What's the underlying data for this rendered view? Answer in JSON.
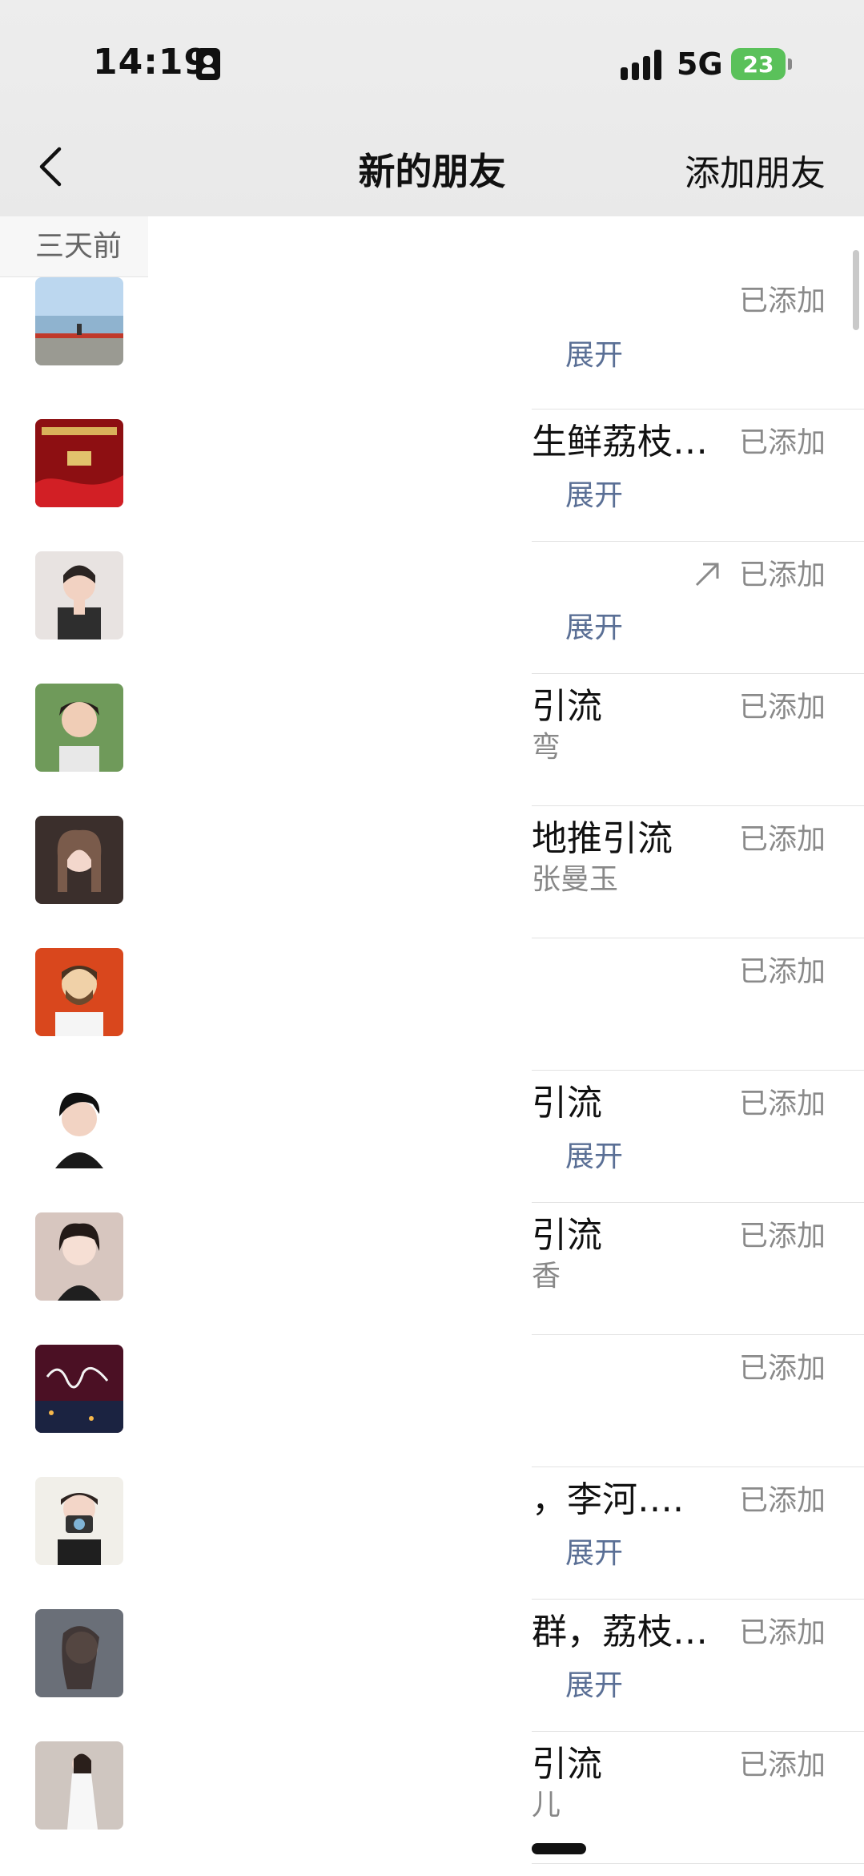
{
  "status_bar": {
    "time": "14:19",
    "network": "5G",
    "battery": "23"
  },
  "nav": {
    "title": "新的朋友",
    "action": "添加朋友"
  },
  "section": {
    "header": "三天前"
  },
  "status_label": "已添加",
  "expand_label": "展开",
  "friends": [
    {
      "name": "",
      "subtitle": "",
      "expand": true,
      "arrow": false,
      "status": "已添加",
      "avatar": "landscape-road"
    },
    {
      "name": "生鲜荔枝…",
      "subtitle": "",
      "expand": true,
      "arrow": false,
      "status": "已添加",
      "avatar": "red-poster"
    },
    {
      "name": "",
      "subtitle": "",
      "expand": true,
      "arrow": true,
      "status": "已添加",
      "avatar": "woman-peace-sign"
    },
    {
      "name": "引流",
      "subtitle": "弯",
      "expand": false,
      "arrow": false,
      "status": "已添加",
      "avatar": "woman-outdoors"
    },
    {
      "name": "地推引流",
      "subtitle": "张曼玉",
      "expand": false,
      "arrow": false,
      "status": "已添加",
      "avatar": "woman-selfie"
    },
    {
      "name": "",
      "subtitle": "",
      "expand": false,
      "arrow": false,
      "status": "已添加",
      "avatar": "cartoon-man"
    },
    {
      "name": "引流",
      "subtitle": "",
      "expand": true,
      "arrow": false,
      "status": "已添加",
      "avatar": "woman-short-hair"
    },
    {
      "name": "引流",
      "subtitle": "香",
      "expand": false,
      "arrow": false,
      "status": "已添加",
      "avatar": "woman-portrait"
    },
    {
      "name": "",
      "subtitle": "",
      "expand": false,
      "arrow": false,
      "status": "已添加",
      "avatar": "calligraphy-night"
    },
    {
      "name": "，李河….",
      "subtitle": "",
      "expand": true,
      "arrow": false,
      "status": "已添加",
      "avatar": "woman-camera"
    },
    {
      "name": "群，荔枝…",
      "subtitle": "",
      "expand": true,
      "arrow": false,
      "status": "已添加",
      "avatar": "woman-side-profile"
    },
    {
      "name": "引流",
      "subtitle": "儿",
      "expand": false,
      "arrow": false,
      "status": "已添加",
      "avatar": "woman-standing"
    }
  ],
  "colors": {
    "nav_background": "#ebebeb",
    "link": "#5a6f95",
    "status_text": "#8a8a8a",
    "battery": "#5ac15a"
  }
}
